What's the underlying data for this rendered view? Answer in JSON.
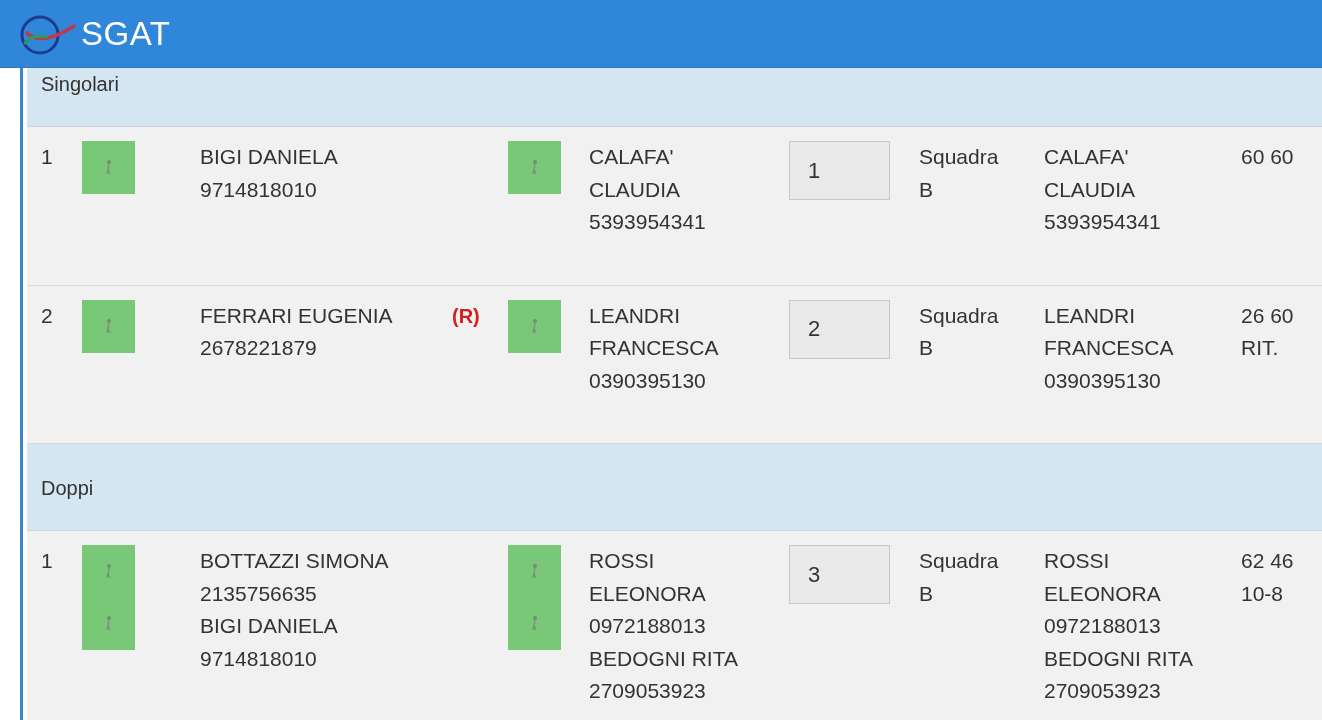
{
  "header": {
    "title": "SGAT"
  },
  "sections": [
    {
      "title": "Singolari",
      "matches": [
        {
          "number": "1",
          "home": {
            "players": [
              {
                "name": "BIGI DANIELA",
                "code": "9714818010"
              }
            ]
          },
          "away": {
            "players": [
              {
                "name": "CALAFA' CLAUDIA",
                "code": "5393954341"
              }
            ]
          },
          "order": "1",
          "team": "Squadra B",
          "winner": {
            "players": [
              {
                "name": "CALAFA' CLAUDIA",
                "code": "5393954341"
              }
            ]
          },
          "score": "60 60"
        },
        {
          "number": "2",
          "home": {
            "players": [
              {
                "name": "FERRARI EUGENIA",
                "code": "2678221879"
              }
            ],
            "flag": "(R)"
          },
          "away": {
            "players": [
              {
                "name": "LEANDRI FRANCESCA",
                "code": "0390395130"
              }
            ]
          },
          "order": "2",
          "team": "Squadra B",
          "winner": {
            "players": [
              {
                "name": "LEANDRI FRANCESCA",
                "code": "0390395130"
              }
            ]
          },
          "score": "26 60 RIT."
        }
      ]
    },
    {
      "title": "Doppi",
      "matches": [
        {
          "number": "1",
          "home": {
            "players": [
              {
                "name": "BOTTAZZI SIMONA",
                "code": "2135756635"
              },
              {
                "name": "BIGI DANIELA",
                "code": "9714818010"
              }
            ]
          },
          "away": {
            "players": [
              {
                "name": "ROSSI ELEONORA",
                "code": "0972188013"
              },
              {
                "name": "BEDOGNI RITA",
                "code": "2709053923"
              }
            ]
          },
          "order": "3",
          "team": "Squadra B",
          "winner": {
            "players": [
              {
                "name": "ROSSI ELEONORA",
                "code": "0972188013"
              },
              {
                "name": "BEDOGNI RITA",
                "code": "2709053923"
              }
            ]
          },
          "score": "62 46 10-8"
        }
      ]
    }
  ]
}
